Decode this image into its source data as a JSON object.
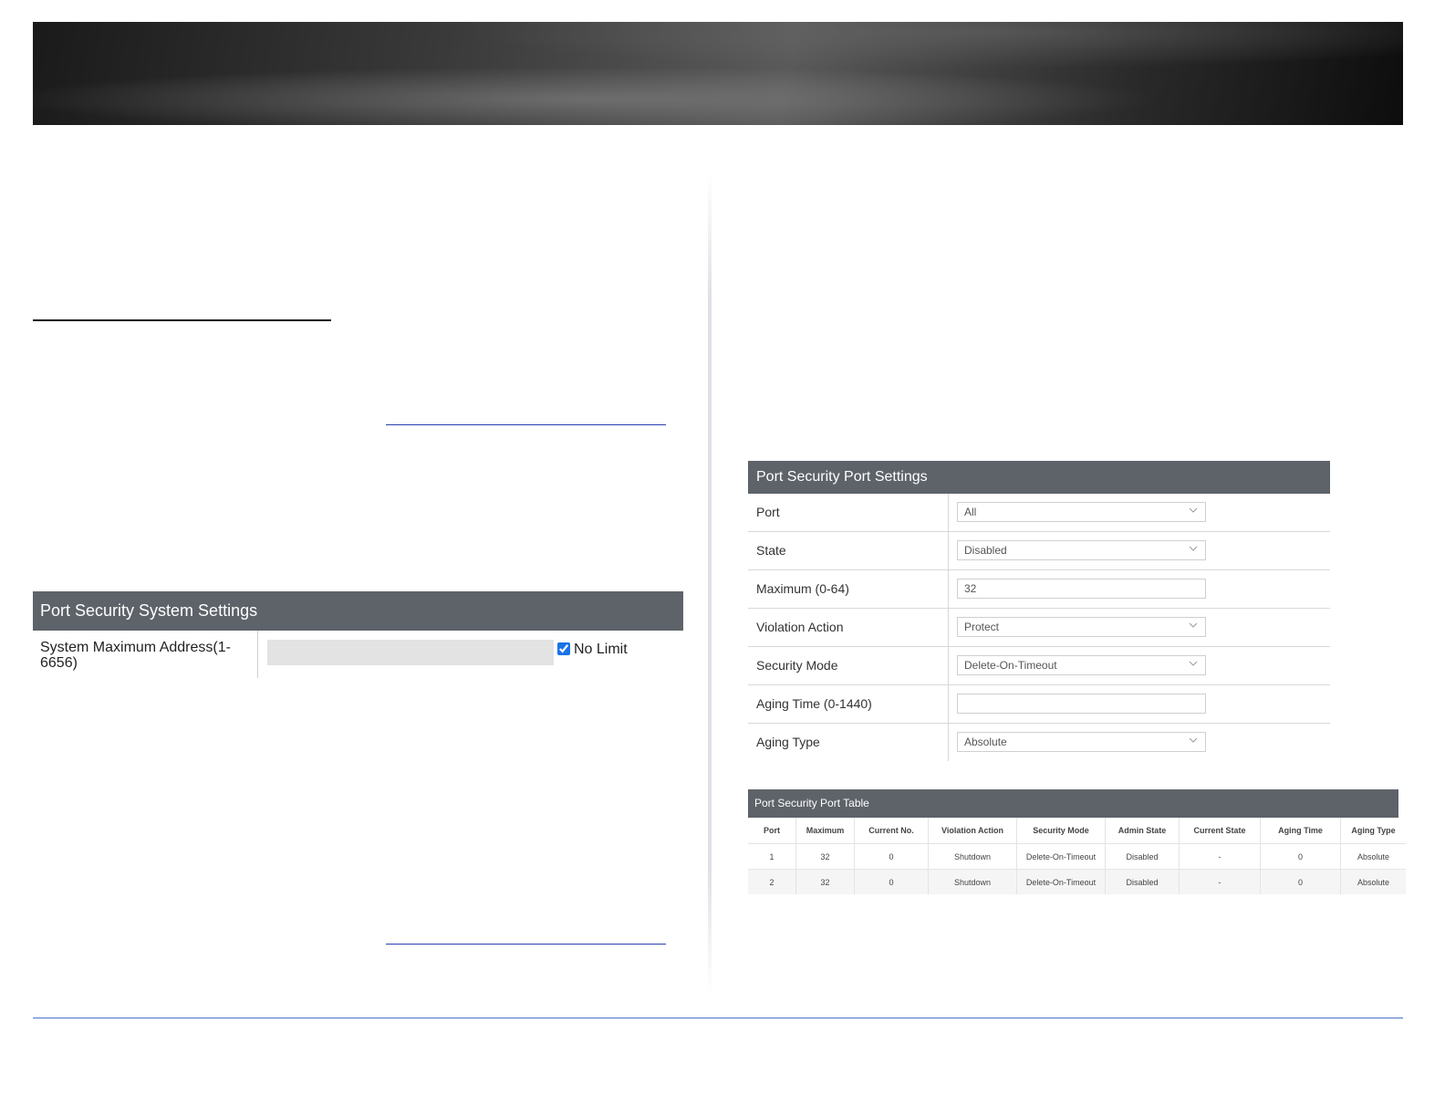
{
  "system_settings": {
    "title": "Port Security System Settings",
    "label": "System Maximum Address(1-6656)",
    "value": "",
    "no_limit_label": "No Limit",
    "no_limit_checked": true
  },
  "port_settings": {
    "title": "Port Security Port Settings",
    "rows": [
      {
        "label": "Port",
        "value": "All",
        "kind": "select"
      },
      {
        "label": "State",
        "value": "Disabled",
        "kind": "select"
      },
      {
        "label": "Maximum (0-64)",
        "value": "32",
        "kind": "input"
      },
      {
        "label": "Violation Action",
        "value": "Protect",
        "kind": "select"
      },
      {
        "label": "Security Mode",
        "value": "Delete-On-Timeout",
        "kind": "select"
      },
      {
        "label": "Aging Time (0-1440)",
        "value": "",
        "kind": "input"
      },
      {
        "label": "Aging Type",
        "value": "Absolute",
        "kind": "select"
      }
    ]
  },
  "port_table": {
    "title": "Port Security Port Table",
    "columns": [
      "Port",
      "Maximum",
      "Current No.",
      "Violation Action",
      "Security Mode",
      "Admin State",
      "Current State",
      "Aging Time",
      "Aging Type"
    ],
    "rows": [
      [
        "1",
        "32",
        "0",
        "Shutdown",
        "Delete-On-Timeout",
        "Disabled",
        "-",
        "0",
        "Absolute"
      ],
      [
        "2",
        "32",
        "0",
        "Shutdown",
        "Delete-On-Timeout",
        "Disabled",
        "-",
        "0",
        "Absolute"
      ]
    ]
  },
  "colors": {
    "panel_header": "#5d6369",
    "link": "#2a3fb0",
    "footer_rule": "#4a73c9"
  }
}
